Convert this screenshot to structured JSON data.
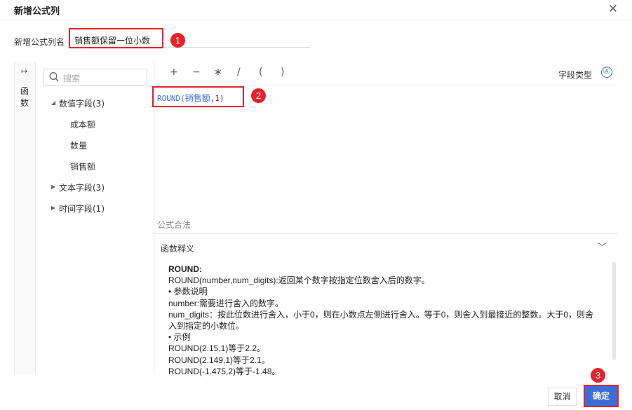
{
  "dialog": {
    "title": "新增公式列"
  },
  "name_field": {
    "label": "新增公式列名",
    "value": "销售额保留一位小数"
  },
  "side_rail": {
    "label": "函数"
  },
  "search": {
    "placeholder": "搜索"
  },
  "tree": {
    "numeric_group": "数值字段(3)",
    "numeric_items": [
      "成本额",
      "数量",
      "销售额"
    ],
    "text_group": "文本字段(3)",
    "time_group": "时间字段(1)"
  },
  "toolbar": {
    "operators": [
      "+",
      "−",
      "∗",
      "/",
      "(",
      ")"
    ],
    "field_type_label": "字段类型",
    "field_type_icon": "Ⓐ"
  },
  "formula": {
    "prefix": "ROUND(",
    "field": "销售额",
    "suffix": ",1)"
  },
  "legal_status": "公式合法",
  "explain": {
    "header": "函数释义",
    "lines": [
      "ROUND:",
      "ROUND(number,num_digits):返回某个数字按指定位数舍入后的数字。",
      "• 参数说明",
      "number:需要进行舍入的数字。",
      "num_digits：按此位数进行舍入，小于0，则在小数点左侧进行舍入。等于0，则舍入到最接近的整数。大于0，则舍",
      "入到指定的小数位。",
      "• 示例",
      "ROUND(2.15,1)等于2.2。",
      "ROUND(2.149,1)等于2.1。",
      "ROUND(-1.475,2)等于-1.48。"
    ]
  },
  "footer": {
    "cancel": "取消",
    "confirm": "确定"
  },
  "annotations": [
    "1",
    "2",
    "3"
  ],
  "colors": {
    "accent": "#3d6ed8",
    "marker": "#e8222a"
  }
}
